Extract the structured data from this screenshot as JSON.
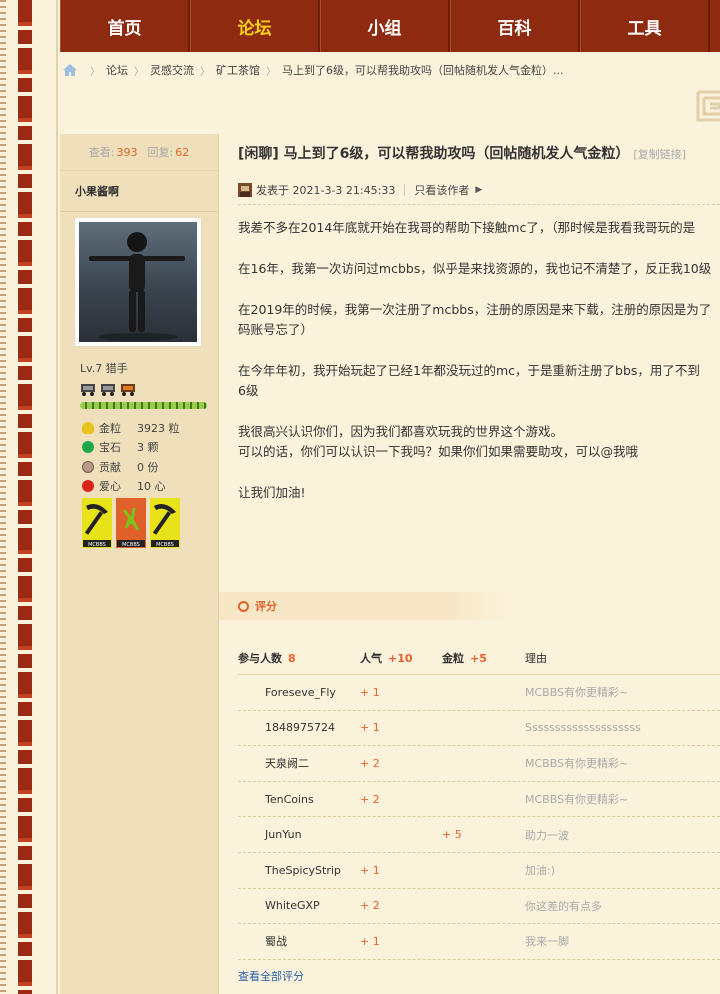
{
  "nav": {
    "items": [
      "首页",
      "论坛",
      "小组",
      "百科",
      "工具"
    ],
    "active_index": 1
  },
  "breadcrumb": {
    "items": [
      "论坛",
      "灵感交流",
      "矿工茶馆",
      "马上到了6级，可以帮我助攻吗（回帖随机发人气金粒）..."
    ]
  },
  "sidebar": {
    "views_label": "查看:",
    "views": "393",
    "replies_label": "回复:",
    "replies": "62",
    "username": "小果酱啊",
    "level": "Lv.7 猎手",
    "credits": [
      {
        "icon": "gold-icon",
        "label": "金粒",
        "value": "3923 粒",
        "color": "#e8c31a"
      },
      {
        "icon": "gem-icon",
        "label": "宝石",
        "value": "3 颗",
        "color": "#1fa84a"
      },
      {
        "icon": "contribution-icon",
        "label": "贡献",
        "value": "0 份",
        "color": "#9a7a6a"
      },
      {
        "icon": "heart-icon",
        "label": "爱心",
        "value": "10 心",
        "color": "#d8261a"
      }
    ],
    "medal_labels": [
      "MCBBS",
      "MCBBS",
      "MCBBS"
    ]
  },
  "post": {
    "title": "[闲聊] 马上到了6级，可以帮我助攻吗（回帖随机发人气金粒）",
    "copy_link": "[复制链接]",
    "posted_at": "发表于 2021-3-3 21:45:33",
    "only_author": "只看该作者",
    "paragraphs": [
      [
        "我差不多在2014年底就开始在我哥的帮助下接触mc了，（那时候是我看我哥玩的是"
      ],
      [
        "在16年，我第一次访问过mcbbs，似乎是来找资源的，我也记不清楚了，反正我10级"
      ],
      [
        "在2019年的时候，我第一次注册了mcbbs，注册的原因是来下载，注册的原因是为了",
        "码账号忘了）"
      ],
      [
        "在今年年初，我开始玩起了已经1年都没玩过的mc，于是重新注册了bbs，用了不到",
        "6级"
      ],
      [
        "我很高兴认识你们，因为我们都喜欢玩我的世界这个游戏。",
        "可以的话，你们可以认识一下我吗？如果你们如果需要助攻，可以@我哦"
      ],
      [
        "让我们加油!"
      ]
    ]
  },
  "rating": {
    "section_label": "评分",
    "headers": {
      "participants": "参与人数",
      "participants_count": "8",
      "popularity": "人气",
      "popularity_total": "+10",
      "gold": "金粒",
      "gold_total": "+5",
      "reason": "理由"
    },
    "rows": [
      {
        "user": "Foreseve_Fly",
        "popularity": "+ 1",
        "gold": "",
        "reason": "MCBBS有你更精彩~"
      },
      {
        "user": "1848975724",
        "popularity": "+ 1",
        "gold": "",
        "reason": "Ssssssssssssssssssss"
      },
      {
        "user": "天泉阙二",
        "popularity": "+ 2",
        "gold": "",
        "reason": "MCBBS有你更精彩~"
      },
      {
        "user": "TenCoins",
        "popularity": "+ 2",
        "gold": "",
        "reason": "MCBBS有你更精彩~"
      },
      {
        "user": "JunYun",
        "popularity": "",
        "gold": "+ 5",
        "reason": "助力一波"
      },
      {
        "user": "TheSpicyStrip",
        "popularity": "+ 1",
        "gold": "",
        "reason": "加油:)"
      },
      {
        "user": "WhiteGXP",
        "popularity": "+ 2",
        "gold": "",
        "reason": "你这差的有点多"
      },
      {
        "user": "蜀战",
        "popularity": "+ 1",
        "gold": "",
        "reason": "我来一脚"
      }
    ],
    "view_all": "查看全部评分"
  }
}
